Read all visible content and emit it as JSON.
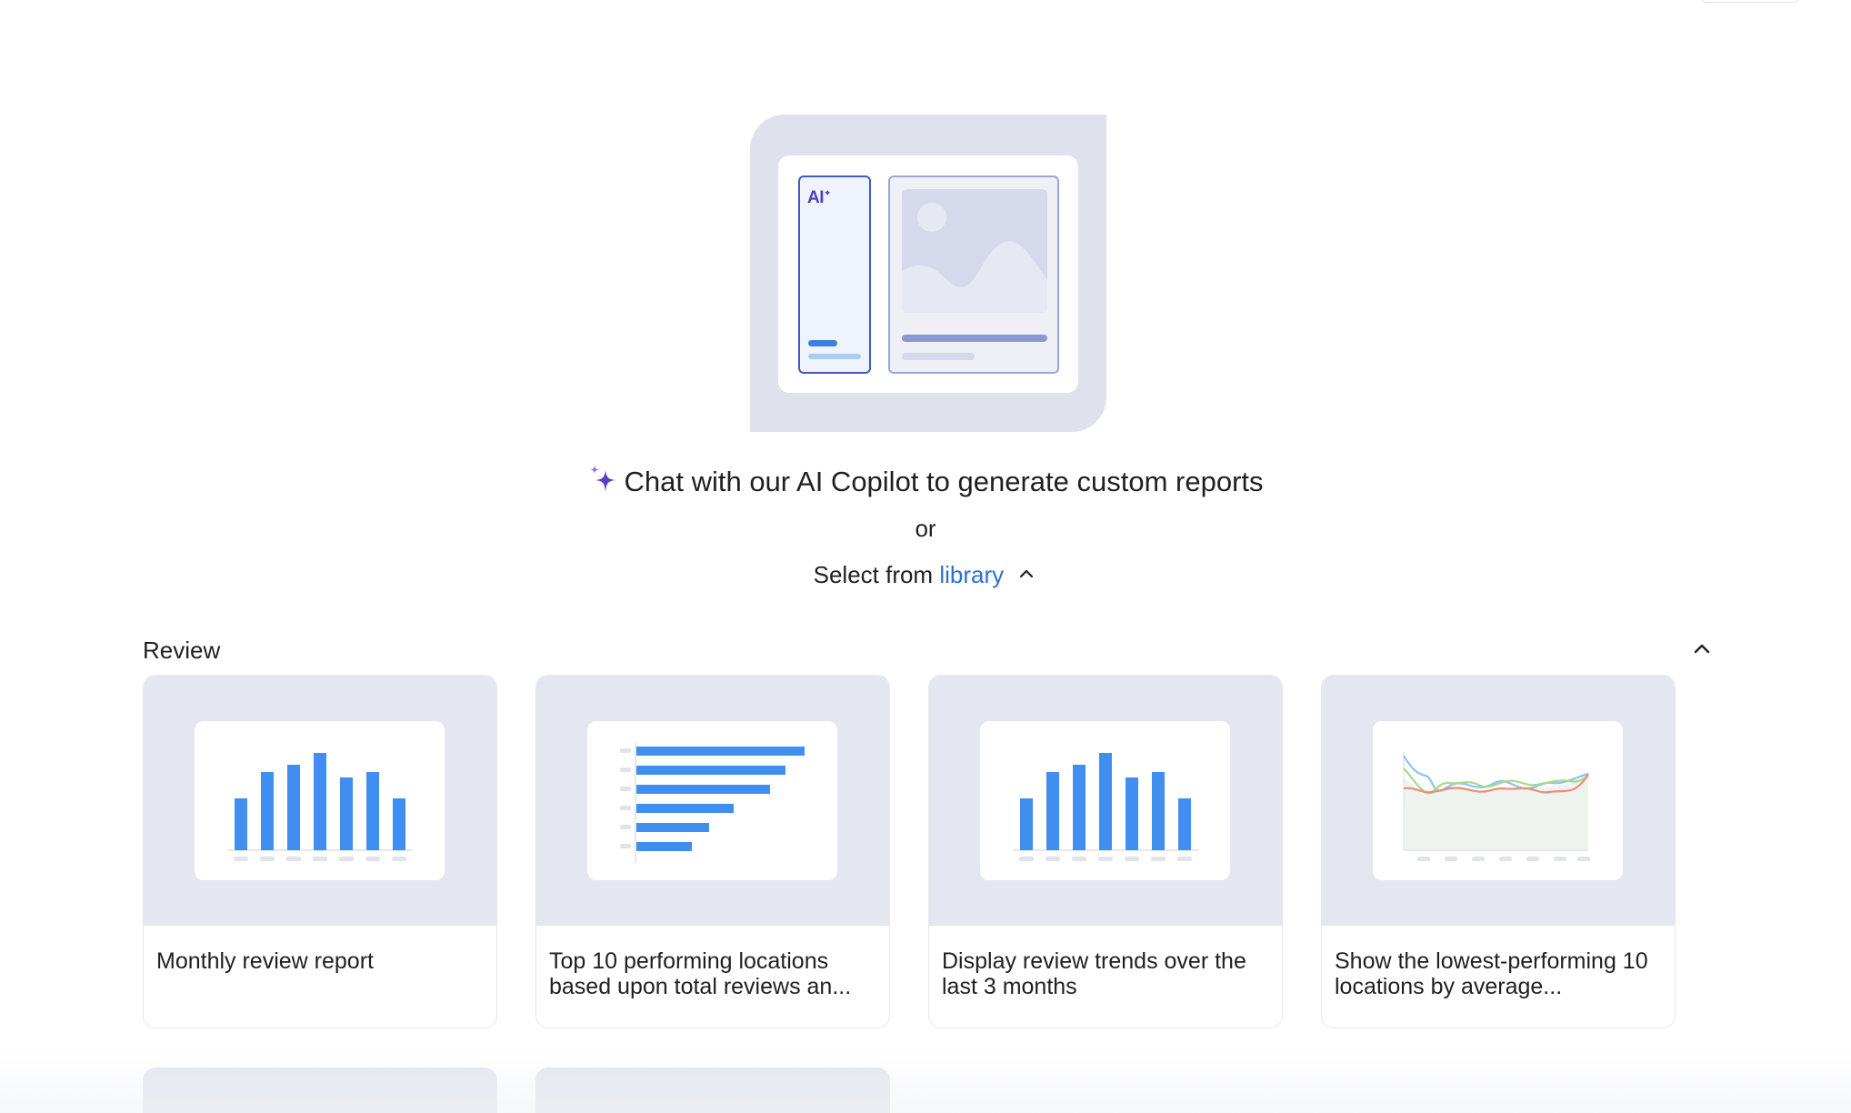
{
  "hero": {
    "ai_badge": "AI",
    "headline": "Chat with our AI Copilot to generate custom reports",
    "or_text": "or",
    "select_prefix": "Select from",
    "library_link": "library"
  },
  "section": {
    "title": "Review"
  },
  "cards": [
    {
      "title": "Monthly review report",
      "thumbnail": "vertical-bar-chart"
    },
    {
      "title": "Top 10 performing locations based upon total reviews an...",
      "thumbnail": "horizontal-bar-chart"
    },
    {
      "title": "Display review trends over the last 3 months",
      "thumbnail": "vertical-bar-chart"
    },
    {
      "title": "Show the lowest-performing 10 locations by average...",
      "thumbnail": "multi-line-chart"
    }
  ],
  "colors": {
    "accent_blue": "#2f6fcf",
    "bar_blue": "#3f8ef0",
    "sparkle_purple": "#5b3fbf",
    "thumb_bg": "#e4e7ef"
  }
}
